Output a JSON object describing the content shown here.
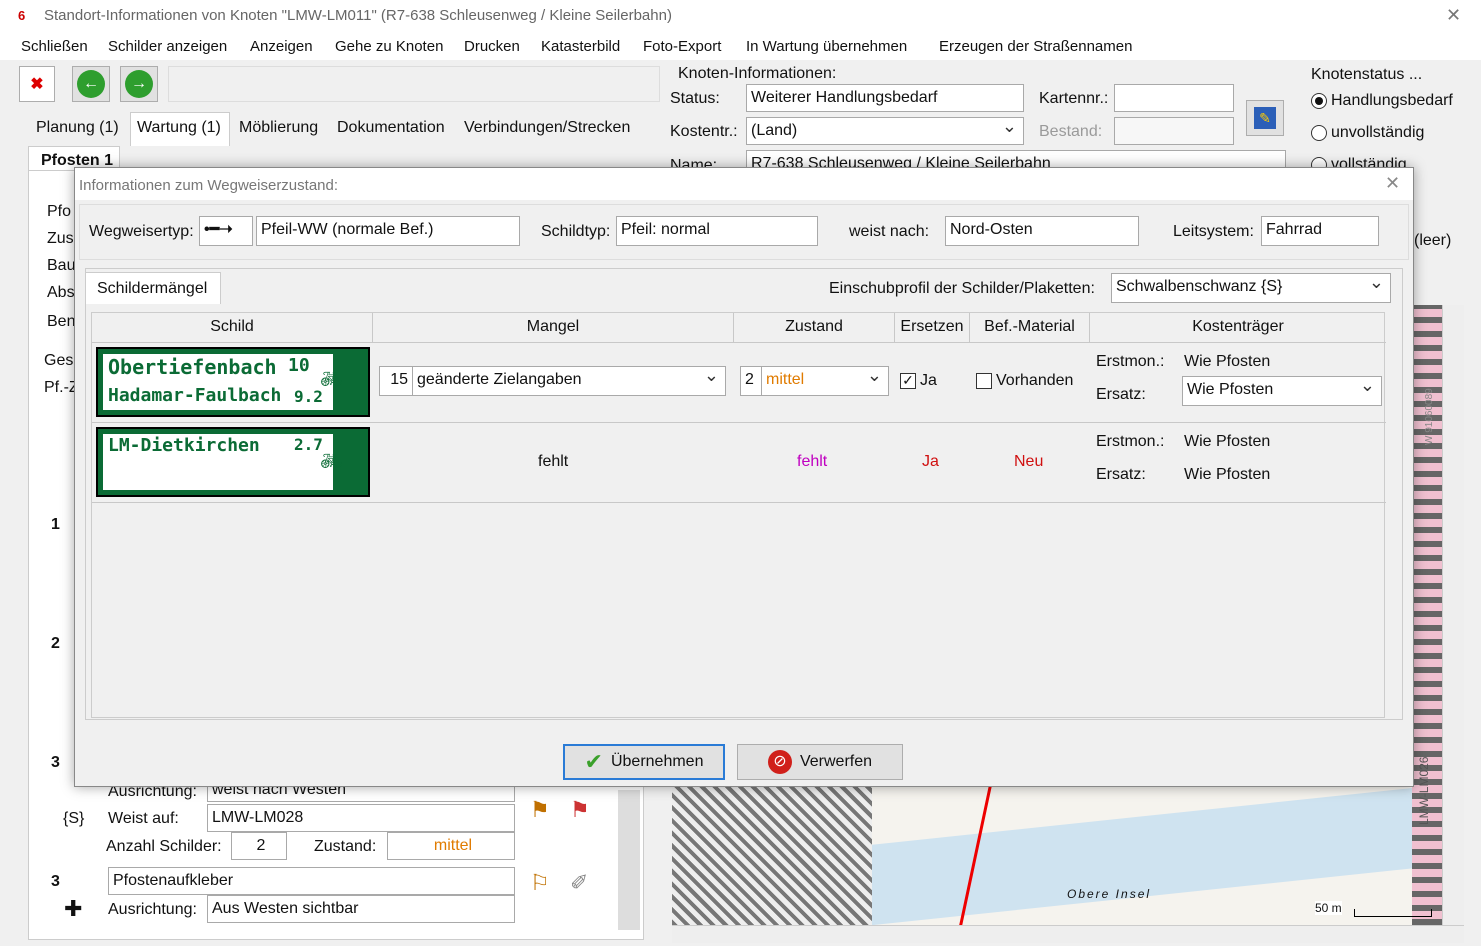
{
  "window": {
    "title": "Standort-Informationen von Knoten \"LMW-LM011\" (R7-638 Schleusenweg / Kleine Seilerbahn)",
    "close": "✕"
  },
  "menu": [
    "Schließen",
    "Schilder anzeigen",
    "Anzeigen",
    "Gehe zu Knoten",
    "Drucken",
    "Katasterbild",
    "Foto-Export",
    "In Wartung übernehmen",
    "Erzeugen der Straßennamen"
  ],
  "tabs": [
    "Planung (1)",
    "Wartung (1)",
    "Möblierung",
    "Dokumentation",
    "Verbindungen/Strecken"
  ],
  "pfosten_tab": "Pfosten 1",
  "left_side_labels": [
    "Pfo",
    "Zus",
    "Bau",
    "Abs",
    "Ben",
    "Ges",
    "Pf.-Z"
  ],
  "left_numbers": [
    "1",
    "2",
    "3"
  ],
  "knoten": {
    "title": "Knoten-Informationen:",
    "status_label": "Status:",
    "status_value": "Weiterer Handlungsbedarf",
    "kartennr_label": "Kartennr.:",
    "kartennr_value": "",
    "kostentr_label": "Kostentr.:",
    "kostentr_value": "(Land)",
    "bestand_label": "Bestand:",
    "name_label": "Name:",
    "name_value": "R7-638 Schleusenweg / Kleine Seilerbahn"
  },
  "knotenstatus": {
    "title": "Knotenstatus ...",
    "options": [
      "Handlungsbedarf",
      "unvollständig",
      "vollständig"
    ],
    "selected": "Handlungsbedarf"
  },
  "leer": "(leer)",
  "dialog": {
    "title": "Informationen zum Wegweiserzustand:",
    "wegweisertyp_label": "Wegweisertyp:",
    "wegweisertyp_value": "Pfeil-WW (normale Bef.)",
    "schildtyp_label": "Schildtyp:",
    "schildtyp_value": "Pfeil: normal",
    "weist_label": "weist nach:",
    "weist_value": "Nord-Osten",
    "leit_label": "Leitsystem:",
    "leit_value": "Fahrrad",
    "tab": "Schildermängel",
    "einschub_label": "Einschubprofil der Schilder/Plaketten:",
    "einschub_value": "Schwalbenschwanz {S}",
    "headers": [
      "Schild",
      "Mangel",
      "Zustand",
      "Ersetzen",
      "Bef.-Material",
      "Kostenträger"
    ],
    "rows": [
      {
        "sign_line1": "Obertiefenbach",
        "sign_km1": "10",
        "sign_line2": "Hadamar-Faulbach",
        "sign_km2": "9.2",
        "mangel_num": "15",
        "mangel": "geänderte Zielangaben",
        "zustand_num": "2",
        "zustand": "mittel",
        "ersetzen": "Ja",
        "befmat": "Vorhanden",
        "erstmon_label": "Erstmon.:",
        "erstmon": "Wie Pfosten",
        "ersatz_label": "Ersatz:",
        "ersatz": "Wie Pfosten"
      },
      {
        "sign_line1": "LM-Dietkirchen",
        "sign_km1": "2.7",
        "mangel": "fehlt",
        "zustand": "fehlt",
        "ersetzen": "Ja",
        "befmat": "Neu",
        "erstmon_label": "Erstmon.:",
        "erstmon": "Wie Pfosten",
        "ersatz_label": "Ersatz:",
        "ersatz": "Wie Pfosten"
      }
    ],
    "ok": "Übernehmen",
    "cancel": "Verwerfen"
  },
  "lower": {
    "ausrichtung_label": "Ausrichtung:",
    "ausrichtung_value": "weist nach Westen",
    "s_tag": "{S}",
    "weist_auf_label": "Weist auf:",
    "weist_auf_value": "LMW-LM028",
    "anzahl_label": "Anzahl Schilder:",
    "anzahl_value": "2",
    "zustand_label": "Zustand:",
    "zustand_value": "mittel",
    "row3_num": "3",
    "pfostenaufkleber": "Pfostenaufkleber",
    "ausrichtung2_label": "Ausrichtung:",
    "ausrichtung2_value": "Aus Westen sichtbar"
  },
  "map": {
    "scale": "50 m",
    "label1": "Obere Insel",
    "label2": "LMW-LM026",
    "label3": "W 91060089"
  },
  "colors": {
    "green": "#0b6b35",
    "orange": "#e07b00",
    "magenta": "#c000c0",
    "red": "#d01010"
  }
}
